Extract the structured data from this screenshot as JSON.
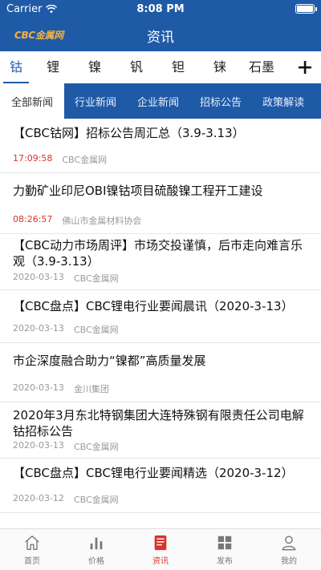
{
  "status_bar": {
    "carrier": "Carrier",
    "time": "8:08 PM"
  },
  "nav": {
    "logo": "CBC金属网",
    "title": "资讯"
  },
  "metal_tabs": [
    "钴",
    "锂",
    "镍",
    "钒",
    "钽",
    "铼",
    "石墨"
  ],
  "category_tabs": [
    "全部新闻",
    "行业新闻",
    "企业新闻",
    "招标公告",
    "政策解读"
  ],
  "news": [
    {
      "headline": "【CBC钴网】招标公告周汇总（3.9-3.13）",
      "time": "17:09:58",
      "source": "CBC金属网"
    },
    {
      "headline": "力勤矿业印尼OBI镍钴项目硫酸镍工程开工建设",
      "time": "08:26:57",
      "source": "佛山市金属材料协会"
    },
    {
      "headline": "【CBC动力市场周评】市场交投谨慎，后市走向难言乐观（3.9-3.13）",
      "time": "2020-03-13",
      "source": "CBC金属网"
    },
    {
      "headline": "【CBC盘点】CBC锂电行业要闻晨讯（2020-3-13）",
      "time": "2020-03-13",
      "source": "CBC金属网"
    },
    {
      "headline": "市企深度融合助力“镍都”高质量发展",
      "time": "2020-03-13",
      "source": "金川集团"
    },
    {
      "headline": "2020年3月东北特钢集团大连特殊钢有限责任公司电解钴招标公告",
      "time": "2020-03-13",
      "source": "CBC金属网"
    },
    {
      "headline": "【CBC盘点】CBC锂电行业要闻精选（2020-3-12）",
      "time": "2020-03-12",
      "source": "CBC金属网"
    }
  ],
  "tabbar": [
    {
      "label": "首页",
      "icon": "home-icon"
    },
    {
      "label": "价格",
      "icon": "bar-chart-icon"
    },
    {
      "label": "资讯",
      "icon": "news-icon"
    },
    {
      "label": "发布",
      "icon": "grid-icon"
    },
    {
      "label": "我的",
      "icon": "user-icon"
    }
  ],
  "colors": {
    "primary": "#1f5aa6",
    "accent_red": "#d9342b",
    "logo": "#f4b23e"
  }
}
